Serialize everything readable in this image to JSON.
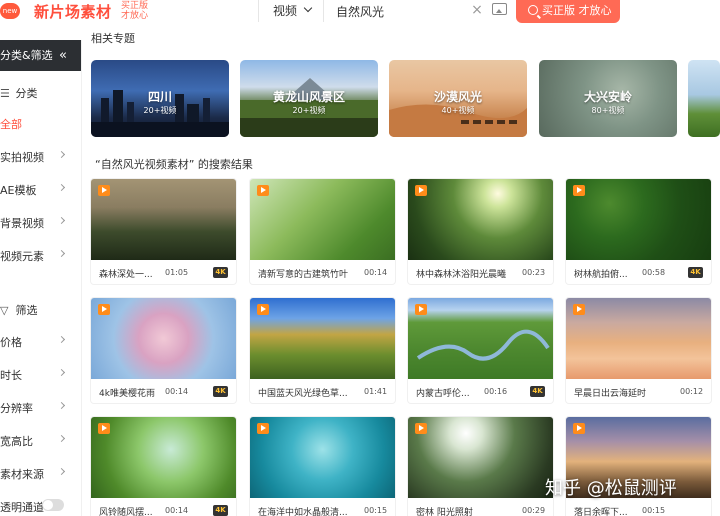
{
  "header": {
    "logo_badge": "new",
    "logo_text": "新片场素材",
    "slogan_line1": "买正版",
    "slogan_line2": "才放心",
    "search_type": "视频",
    "search_value": "自然风光",
    "buy_button": "买正版 才放心"
  },
  "sidebar": {
    "top_label": "分类&筛选",
    "collapse_icon": "«",
    "category_header": "分类",
    "categories": [
      {
        "label": "全部",
        "active": true
      },
      {
        "label": "实拍视频"
      },
      {
        "label": "AE模板"
      },
      {
        "label": "背景视频"
      },
      {
        "label": "视频元素"
      }
    ],
    "filter_header": "筛选",
    "filters": [
      "价格",
      "时长",
      "分辨率",
      "宽高比",
      "素材来源"
    ],
    "toggle_label": "透明通道"
  },
  "topics_title": "相关专题",
  "topics": [
    {
      "name": "四川",
      "count": "20+视频"
    },
    {
      "name": "黄龙山风景区",
      "count": "20+视频"
    },
    {
      "name": "沙漠风光",
      "count": "40+视频"
    },
    {
      "name": "大兴安岭",
      "count": "80+视频"
    },
    {
      "name": "",
      "count": ""
    }
  ],
  "results_title": "“自然风光视频素材” 的搜索结果",
  "videos": [
    {
      "title": "森林深处一...",
      "duration": "01:05",
      "badge": "4K"
    },
    {
      "title": "清新写意的古建筑竹叶",
      "duration": "00:14",
      "badge": ""
    },
    {
      "title": "林中森林沐浴阳光晨曦",
      "duration": "00:23",
      "badge": ""
    },
    {
      "title": "树林航拍俯...",
      "duration": "00:58",
      "badge": "4K"
    },
    {
      "title": "4k唯美樱花雨",
      "duration": "00:14",
      "badge": "4K"
    },
    {
      "title": "中国蓝天风光绿色草...",
      "duration": "01:41",
      "badge": ""
    },
    {
      "title": "内蒙古呼伦...",
      "duration": "00:16",
      "badge": "4K"
    },
    {
      "title": "早晨日出云海延时",
      "duration": "00:12",
      "badge": ""
    },
    {
      "title": "风铃随风摆...",
      "duration": "00:14",
      "badge": "4K"
    },
    {
      "title": "在海洋中如水晶般清...",
      "duration": "00:15",
      "badge": ""
    },
    {
      "title": "密林 阳光照射",
      "duration": "00:29",
      "badge": ""
    },
    {
      "title": "落日余晖下...",
      "duration": "00:15",
      "badge": ""
    }
  ],
  "watermark": "知乎 @松鼠测评"
}
